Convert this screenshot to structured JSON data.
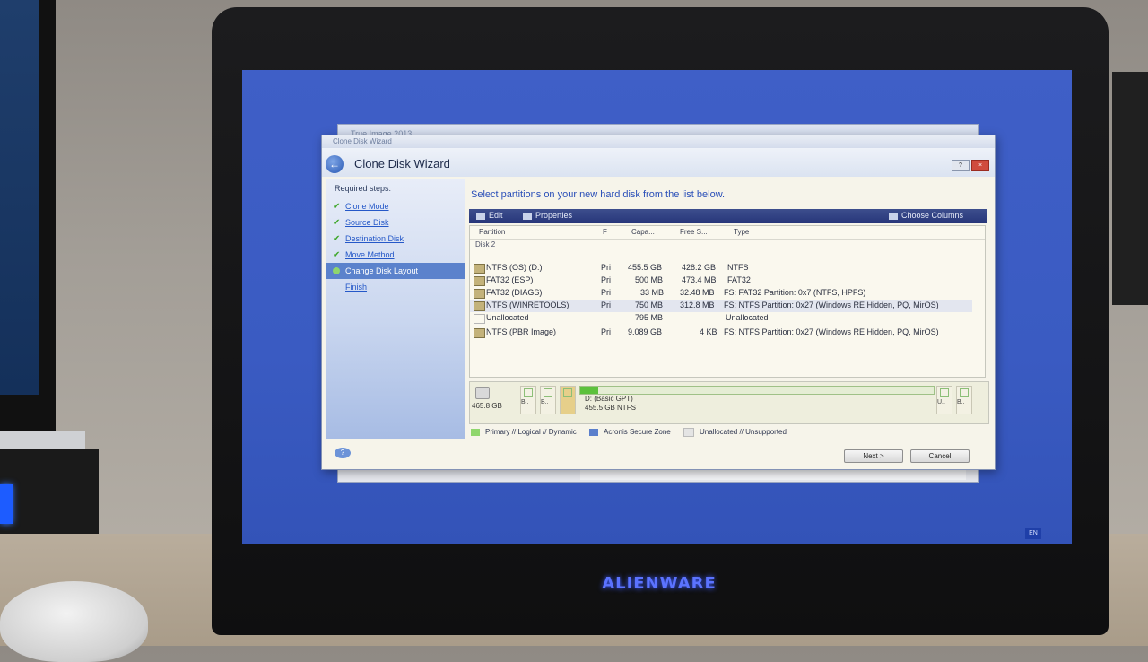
{
  "device": {
    "brand": "ALIENWARE",
    "language": "EN"
  },
  "background_window": {
    "title": "True Image 2013"
  },
  "wizard": {
    "caption": "Clone Disk Wizard",
    "title": "Clone Disk Wizard",
    "steps_heading": "Required steps:",
    "steps": [
      {
        "label": "Clone Mode",
        "state": "done"
      },
      {
        "label": "Source Disk",
        "state": "done"
      },
      {
        "label": "Destination Disk",
        "state": "done"
      },
      {
        "label": "Move Method",
        "state": "done"
      },
      {
        "label": "Change Disk Layout",
        "state": "active"
      },
      {
        "label": "Finish",
        "state": "pending"
      }
    ],
    "instruction": "Select partitions on your new hard disk from the list below.",
    "toolbar": {
      "edit": "Edit",
      "properties": "Properties",
      "choose_columns": "Choose Columns"
    },
    "columns": {
      "partition": "Partition",
      "flags": "F",
      "capacity": "Capa...",
      "free_space": "Free S...",
      "type": "Type"
    },
    "disk_group": "Disk 2",
    "partitions": [
      {
        "name": "NTFS (OS) (D:)",
        "flag": "Pri",
        "capacity": "455.5 GB",
        "free": "428.2 GB",
        "type": "NTFS"
      },
      {
        "name": "FAT32 (ESP)",
        "flag": "Pri",
        "capacity": "500 MB",
        "free": "473.4 MB",
        "type": "FAT32"
      },
      {
        "name": "FAT32 (DIAGS)",
        "flag": "Pri",
        "capacity": "33 MB",
        "free": "32.48 MB",
        "type": "FS: FAT32 Partition: 0x7 (NTFS, HPFS)"
      },
      {
        "name": "NTFS (WINRETOOLS)",
        "flag": "Pri",
        "capacity": "750 MB",
        "free": "312.8 MB",
        "type": "FS: NTFS Partition: 0x27 (Windows RE Hidden, PQ, MirOS)"
      },
      {
        "name": "Unallocated",
        "flag": "",
        "capacity": "795 MB",
        "free": "",
        "type": "Unallocated"
      },
      {
        "name": "NTFS (PBR Image)",
        "flag": "Pri",
        "capacity": "9.089 GB",
        "free": "4 KB",
        "type": "FS: NTFS Partition: 0x27 (Windows RE Hidden, PQ, MirOS)"
      }
    ],
    "diskmap": {
      "disk_size": "465.8 GB",
      "mini_labels": [
        "B..",
        "B..",
        "",
        "U..",
        "B.."
      ],
      "main_line1": "D: (Basic GPT)",
      "main_line2": "455.5 GB  NTFS"
    },
    "legend": {
      "primary": "Primary // Logical // Dynamic",
      "secure_zone": "Acronis Secure Zone",
      "unallocated": "Unallocated // Unsupported"
    },
    "buttons": {
      "next": "Next >",
      "cancel": "Cancel"
    }
  }
}
